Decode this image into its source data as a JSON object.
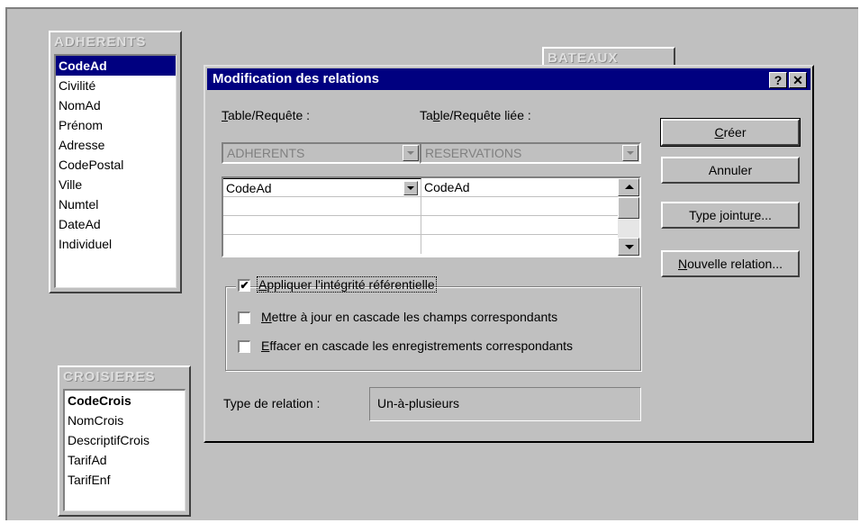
{
  "tables": {
    "adherents": {
      "title": "ADHERENTS",
      "fields": [
        "CodeAd",
        "Civilité",
        "NomAd",
        "Prénom",
        "Adresse",
        "CodePostal",
        "Ville",
        "Numtel",
        "DateAd",
        "Individuel"
      ]
    },
    "bateaux": {
      "title": "BATEAUX"
    },
    "croisieres": {
      "title": "CROISIERES",
      "fields": [
        "CodeCrois",
        "NomCrois",
        "DescriptifCrois",
        "TarifAd",
        "TarifEnf"
      ]
    }
  },
  "dialog": {
    "title": "Modification des relations",
    "help_btn": "?",
    "close_btn": "✕",
    "table_label_prefix": "",
    "table_label_ul": "T",
    "table_label_rest": "able/Requête :",
    "linked_label_prefix": "Ta",
    "linked_label_ul": "b",
    "linked_label_rest": "le/Requête liée :",
    "table_value": "ADHERENTS",
    "linked_value": "RESERVATIONS",
    "grid": {
      "left": [
        "CodeAd",
        "",
        "",
        ""
      ],
      "right": [
        "CodeAd",
        "",
        "",
        ""
      ]
    },
    "buttons": {
      "create_ul": "C",
      "create_rest": "réer",
      "cancel": "Annuler",
      "join_prefix": "Type jointu",
      "join_ul": "r",
      "join_rest": "e...",
      "new_ul": "N",
      "new_rest": "ouvelle relation..."
    },
    "integrity": {
      "checked": true,
      "ul": "A",
      "rest": "ppliquer l'intégrité référentielle"
    },
    "cascade_update": {
      "checked": false,
      "ul": "M",
      "rest": "ettre à jour en cascade les champs correspondants"
    },
    "cascade_delete": {
      "checked": false,
      "ul": "E",
      "rest": "ffacer en cascade les enregistrements correspondants"
    },
    "relation_type_label": "Type de relation :",
    "relation_type_value": "Un-à-plusieurs"
  }
}
